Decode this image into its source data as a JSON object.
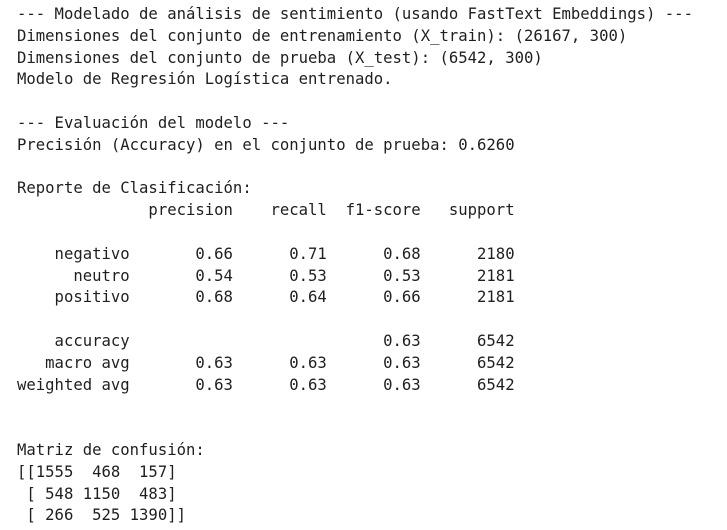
{
  "output": {
    "lines": [
      "--- Modelado de análisis de sentimiento (usando FastText Embeddings) ---",
      "Dimensiones del conjunto de entrenamiento (X_train): (26167, 300)",
      "Dimensiones del conjunto de prueba (X_test): (6542, 300)",
      "Modelo de Regresión Logística entrenado.",
      "",
      "--- Evaluación del modelo ---",
      "Precisión (Accuracy) en el conjunto de prueba: 0.6260",
      "",
      "Reporte de Clasificación:",
      "              precision    recall  f1-score   support",
      "",
      "    negativo       0.66      0.71      0.68      2180",
      "      neutro       0.54      0.53      0.53      2181",
      "    positivo       0.68      0.64      0.66      2181",
      "",
      "    accuracy                           0.63      6542",
      "   macro avg       0.63      0.63      0.63      6542",
      "weighted avg       0.63      0.63      0.63      6542",
      "",
      "",
      "Matriz de confusión:",
      "[[1555  468  157]",
      " [ 548 1150  483]",
      " [ 266  525 1390]]"
    ]
  }
}
